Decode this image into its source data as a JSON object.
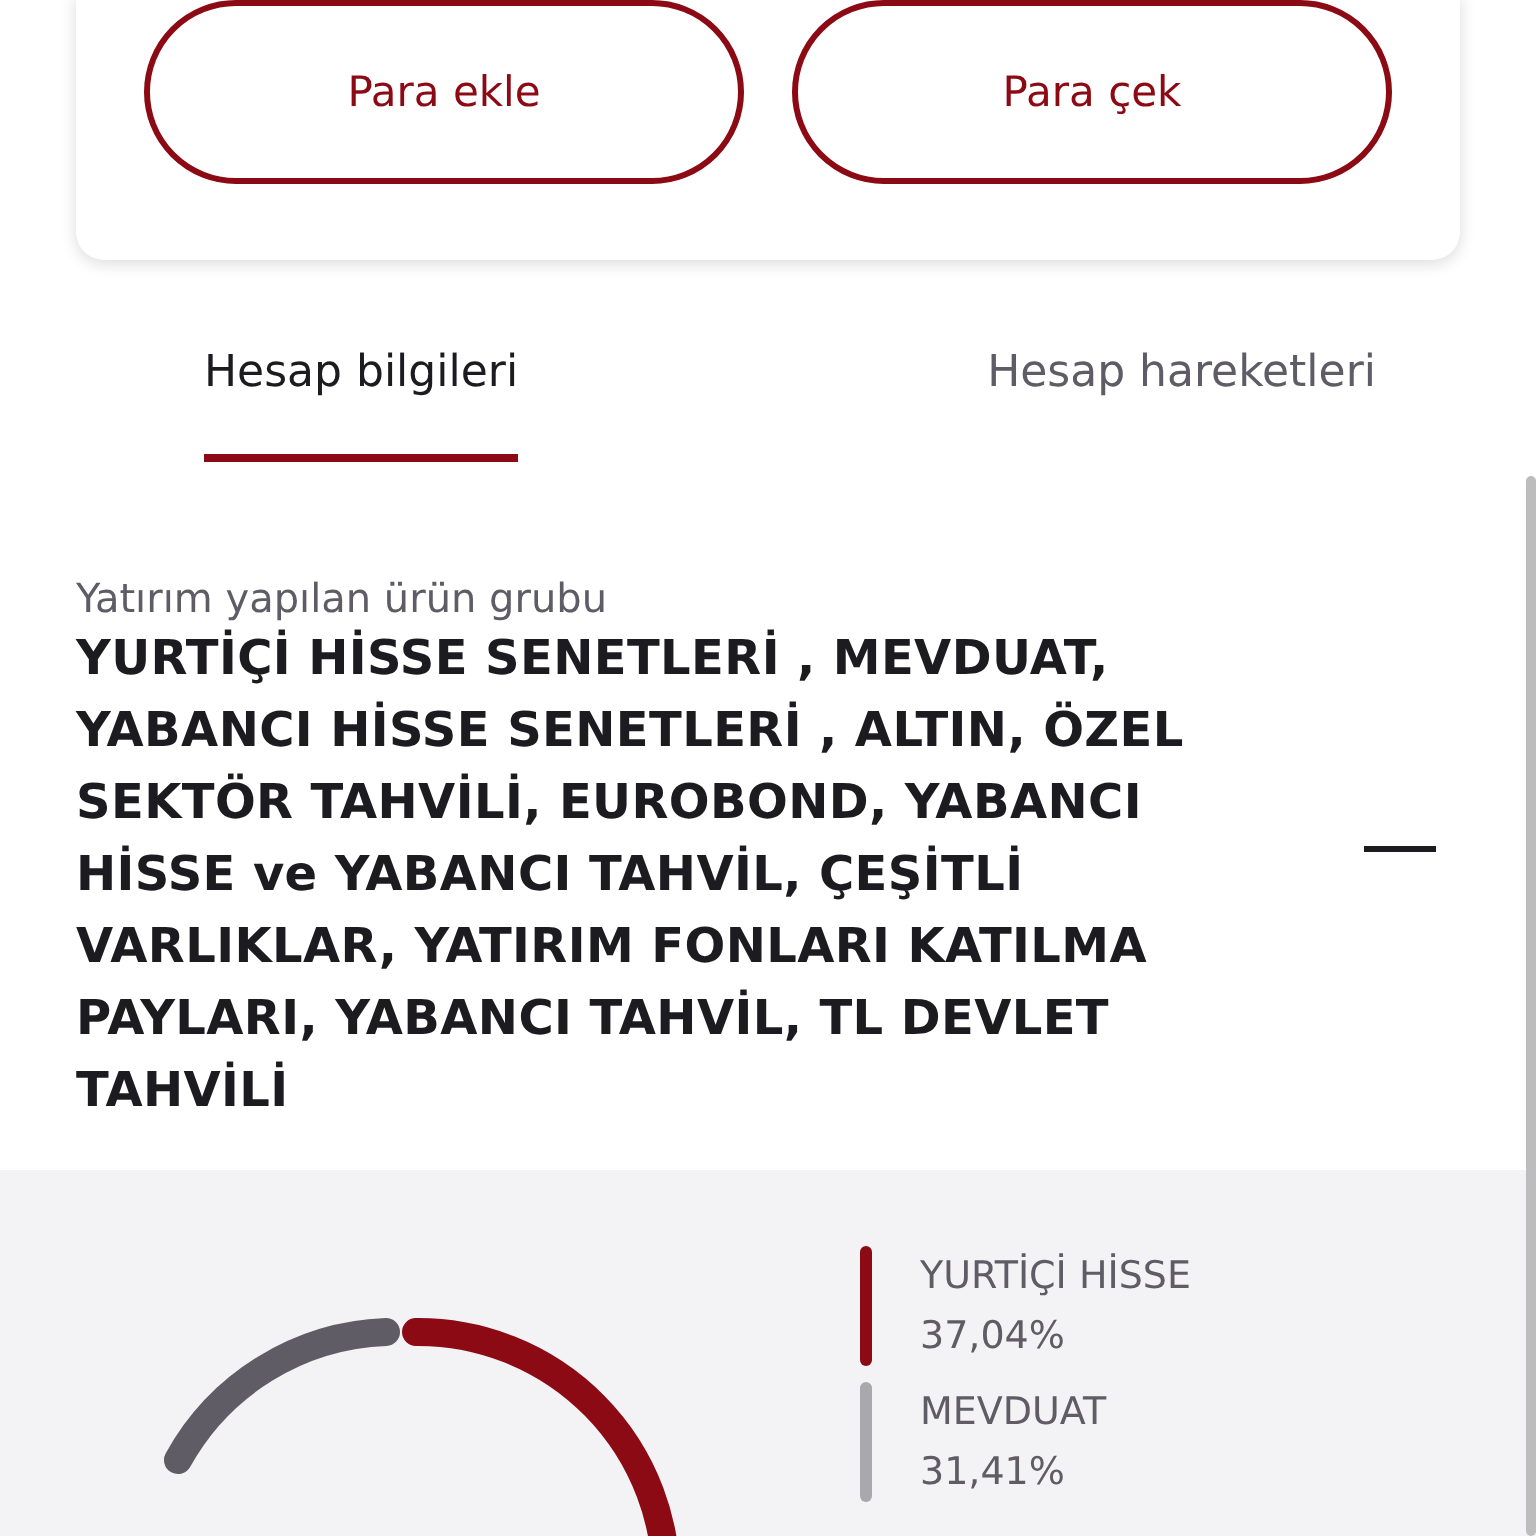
{
  "actions": [
    {
      "label": "Para ekle"
    },
    {
      "label": "Para çek"
    }
  ],
  "tabs": [
    {
      "label": "Hesap bilgileri",
      "selected": true
    },
    {
      "label": "Hesap hareketleri",
      "selected": false
    }
  ],
  "product_group": {
    "label": "Yatırım yapılan ürün grubu",
    "value": "YURTİÇİ HİSSE SENETLERİ , MEVDUAT, YABANCI HİSSE SENETLERİ , ALTIN, ÖZEL SEKTÖR TAHVİLİ, EUROBOND, YABANCI HİSSE ve YABANCI TAHVİL, ÇEŞİTLİ VARLIKLAR, YATIRIM FONLARI KATILMA PAYLARI, YABANCI TAHVİL, TL DEVLET TAHVİLİ",
    "expanded": true
  },
  "legend": [
    {
      "name": "YURTİÇİ HİSSE",
      "percent": "37,04%",
      "color": "#8b0a14"
    },
    {
      "name": "MEVDUAT",
      "percent": "31,41%",
      "color": "#a9a8ad"
    }
  ]
}
